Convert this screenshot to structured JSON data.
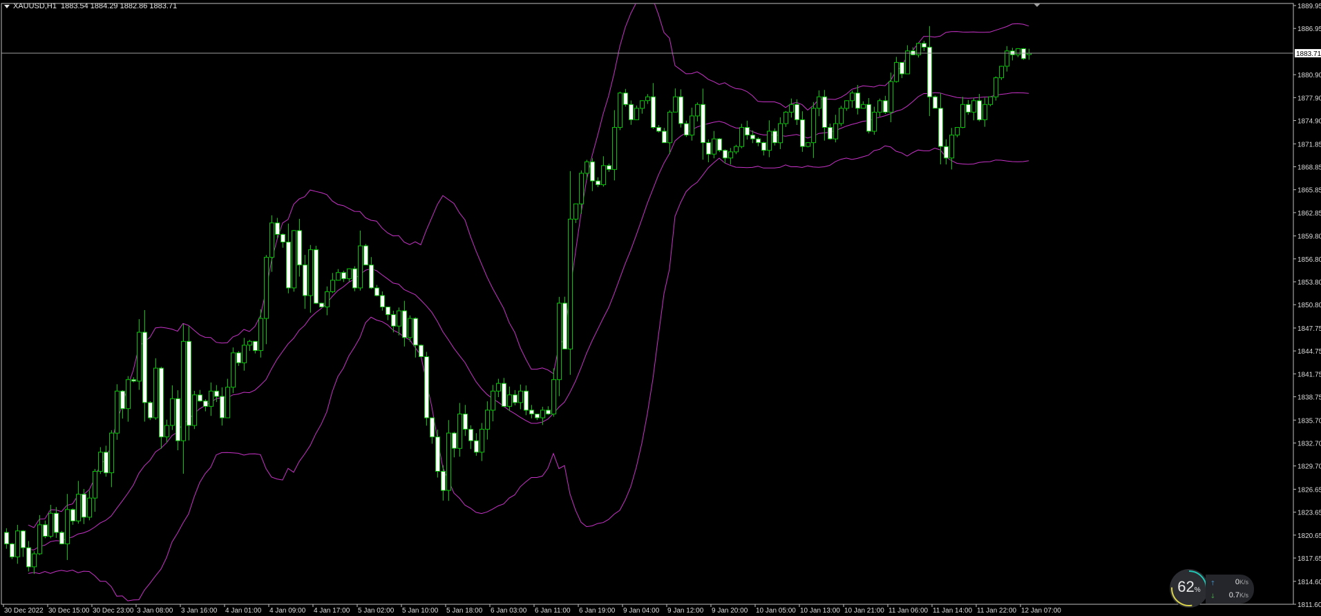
{
  "header": {
    "symbol": "XAUUSD,H1",
    "ohlc": "1883.54 1884.29 1882.86 1883.71"
  },
  "colors": {
    "background": "#000000",
    "bull": "#00c800",
    "bear_body": "#ffffff",
    "bands": "#c832c8",
    "axis_text": "#dddddd",
    "grid_frame": "#c0c0c0"
  },
  "chart_data": {
    "type": "candlestick",
    "symbol": "XAUUSD",
    "timeframe": "H1",
    "indicator": "Bollinger Bands (20, 2)",
    "ylim": [
      1811.6,
      1889.95
    ],
    "current_price": "1883.71",
    "y_ticks": [
      "1889.95",
      "1886.95",
      "1880.90",
      "1877.90",
      "1874.90",
      "1871.85",
      "1868.85",
      "1865.85",
      "1862.85",
      "1859.80",
      "1856.80",
      "1853.80",
      "1850.80",
      "1847.75",
      "1844.75",
      "1841.75",
      "1838.75",
      "1835.70",
      "1832.70",
      "1829.70",
      "1826.65",
      "1823.65",
      "1820.65",
      "1817.65",
      "1814.60",
      "1811.60"
    ],
    "x_ticks": [
      "30 Dec 2022",
      "30 Dec 15:00",
      "30 Dec 23:00",
      "3 Jan 08:00",
      "3 Jan 16:00",
      "4 Jan 01:00",
      "4 Jan 09:00",
      "4 Jan 17:00",
      "5 Jan 02:00",
      "5 Jan 10:00",
      "5 Jan 18:00",
      "6 Jan 03:00",
      "6 Jan 11:00",
      "6 Jan 19:00",
      "9 Jan 04:00",
      "9 Jan 12:00",
      "9 Jan 20:00",
      "10 Jan 05:00",
      "10 Jan 13:00",
      "10 Jan 21:00",
      "11 Jan 06:00",
      "11 Jan 14:00",
      "11 Jan 22:00",
      "12 Jan 07:00"
    ],
    "x_tick_every_bars": 8,
    "closes": [
      1819.5,
      1817.8,
      1821.2,
      1819.0,
      1816.5,
      1818.2,
      1822.0,
      1820.5,
      1823.5,
      1821.0,
      1819.5,
      1824.0,
      1822.5,
      1826.0,
      1823.0,
      1825.5,
      1829.0,
      1831.5,
      1828.8,
      1834.0,
      1839.5,
      1837.2,
      1841.0,
      1840.8,
      1847.2,
      1838.0,
      1836.0,
      1842.5,
      1833.5,
      1835.0,
      1838.5,
      1833.0,
      1846.0,
      1835.0,
      1839.0,
      1838.2,
      1837.5,
      1839.5,
      1838.8,
      1836.0,
      1840.0,
      1844.5,
      1843.2,
      1845.5,
      1846.0,
      1844.8,
      1849.0,
      1857.0,
      1861.5,
      1860.0,
      1859.0,
      1853.0,
      1860.5,
      1856.0,
      1852.0,
      1858.0,
      1851.0,
      1850.5,
      1852.5,
      1854.0,
      1855.0,
      1854.2,
      1855.5,
      1853.0,
      1858.5,
      1856.0,
      1853.0,
      1852.0,
      1850.5,
      1849.5,
      1848.0,
      1850.0,
      1846.5,
      1849.0,
      1845.5,
      1844.0,
      1836.0,
      1833.5,
      1829.0,
      1826.5,
      1834.0,
      1832.0,
      1836.5,
      1834.5,
      1833.0,
      1831.5,
      1834.5,
      1837.0,
      1839.5,
      1840.5,
      1837.5,
      1839.0,
      1838.0,
      1839.5,
      1837.0,
      1836.5,
      1836.0,
      1837.0,
      1836.5,
      1841.0,
      1851.0,
      1845.0,
      1862.0,
      1864.0,
      1868.0,
      1869.5,
      1867.0,
      1866.5,
      1869.0,
      1868.5,
      1874.0,
      1878.5,
      1877.0,
      1875.0,
      1876.5,
      1877.5,
      1878.0,
      1874.0,
      1873.5,
      1872.0,
      1876.0,
      1878.0,
      1874.5,
      1873.0,
      1875.5,
      1877.0,
      1872.0,
      1870.5,
      1872.5,
      1871.0,
      1870.0,
      1870.8,
      1871.5,
      1874.0,
      1873.0,
      1872.5,
      1872.0,
      1871.0,
      1873.5,
      1872.0,
      1874.5,
      1876.0,
      1877.0,
      1875.0,
      1871.5,
      1872.0,
      1876.5,
      1878.0,
      1874.0,
      1872.5,
      1874.5,
      1876.5,
      1877.5,
      1878.5,
      1876.5,
      1877.0,
      1873.5,
      1876.0,
      1877.5,
      1876.0,
      1880.0,
      1882.5,
      1881.0,
      1884.0,
      1883.5,
      1885.0,
      1884.5,
      1878.0,
      1876.5,
      1871.5,
      1870.0,
      1873.0,
      1874.0,
      1877.0,
      1876.0,
      1877.5,
      1875.0,
      1877.0,
      1878.0,
      1880.5,
      1882.0,
      1884.0,
      1883.5,
      1884.3,
      1883.0,
      1883.71
    ],
    "first_open": 1821.0,
    "last_bar": {
      "open": 1883.54,
      "high": 1884.29,
      "low": 1882.86,
      "close": 1883.71
    },
    "grid": false
  },
  "widget": {
    "percent": 62,
    "percent_label": "62",
    "percent_unit": "%",
    "up_value": "0",
    "down_value": "0.7",
    "unit": "K/s"
  }
}
